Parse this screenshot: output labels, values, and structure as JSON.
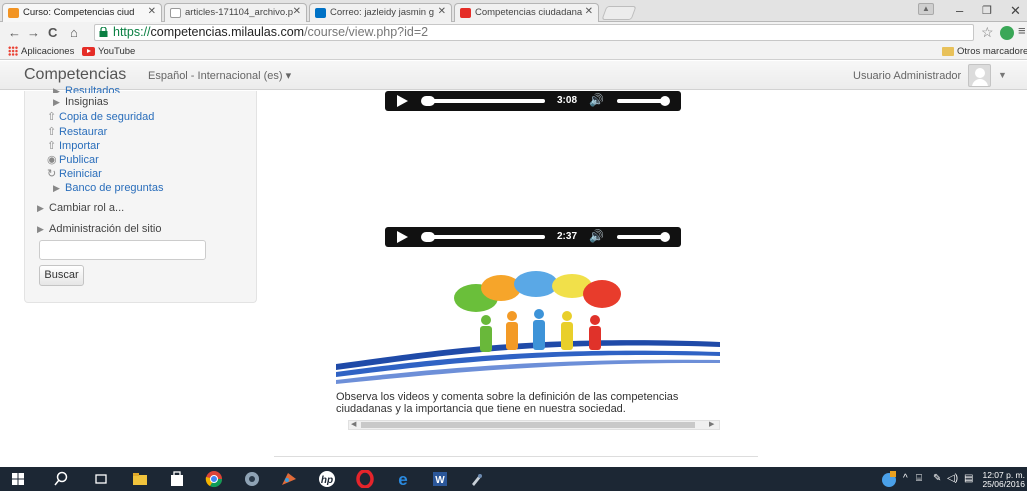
{
  "browser": {
    "tabs": [
      {
        "label": "Curso: Competencias ciud",
        "favicon": "moodle-icon",
        "favicon_color": "#f29423",
        "active": true
      },
      {
        "label": "articles-171104_archivo.p",
        "favicon": "document-icon",
        "favicon_color": "#ffffff",
        "active": false
      },
      {
        "label": "Correo: jazleidy jasmin g",
        "favicon": "mail-icon",
        "favicon_color": "#0072c6",
        "active": false
      },
      {
        "label": "Competencias ciudadana",
        "favicon": "youtube-icon",
        "favicon_color": "#e52d27",
        "active": false
      }
    ],
    "url": {
      "scheme": "https://",
      "host": "competencias.milaulas.com",
      "path": "/course/view.php?id=2"
    },
    "bookmarks": {
      "apps": "Aplicaciones",
      "youtube": "YouTube",
      "other": "Otros marcadores"
    }
  },
  "navbar": {
    "brand": "Competencias",
    "language": "Español - Internacional (es) ▾",
    "user": "Usuario Administrador"
  },
  "sidebar": {
    "cut_item": "Resultados",
    "items": [
      {
        "label": "Insignias",
        "icon": "triangle-right-icon",
        "style": "plain"
      },
      {
        "label": "Copia de seguridad",
        "icon": "backup-icon",
        "style": "link"
      },
      {
        "label": "Restaurar",
        "icon": "restore-icon",
        "style": "link"
      },
      {
        "label": "Importar",
        "icon": "import-icon",
        "style": "link"
      },
      {
        "label": "Publicar",
        "icon": "publish-icon",
        "style": "link"
      },
      {
        "label": "Reiniciar",
        "icon": "reset-icon",
        "style": "link"
      },
      {
        "label": "Banco de preguntas",
        "icon": "triangle-right-icon",
        "style": "link"
      }
    ],
    "switch_role": "Cambiar rol a...",
    "site_admin": "Administración del sitio",
    "search_value": "",
    "search_button": "Buscar"
  },
  "main": {
    "players": [
      {
        "time": "3:08",
        "progress": 0.02,
        "volume": 1.0
      },
      {
        "time": "2:37",
        "progress": 0.02,
        "volume": 1.0
      }
    ],
    "caption": "Observa los videos y comenta sobre la definición de las competencias ciudadanas y la importancia que tiene en nuestra sociedad."
  },
  "taskbar": {
    "time": "12:07 p. m.",
    "date": "25/06/2016"
  },
  "colors": {
    "link": "#2a6ebb",
    "taskbar": "#1c2734",
    "https_green": "#0b8043"
  }
}
